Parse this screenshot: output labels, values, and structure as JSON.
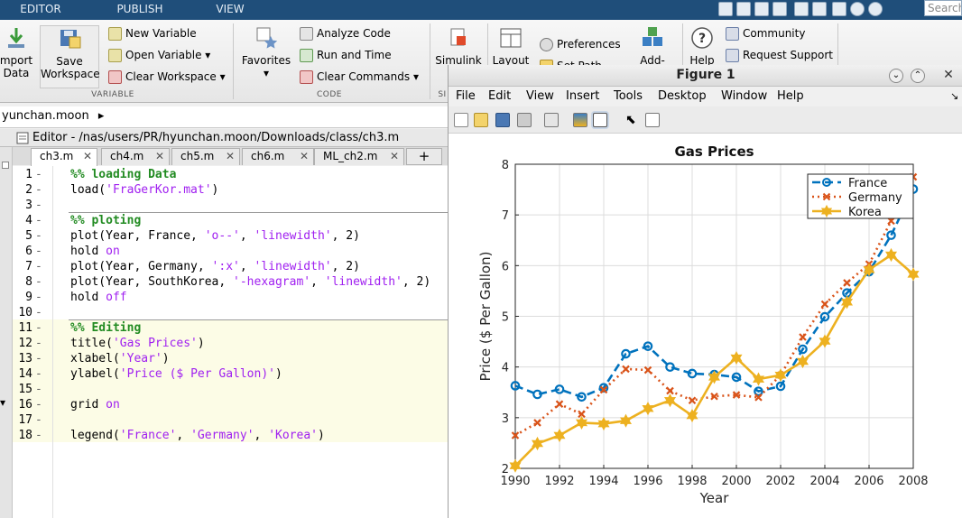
{
  "tabs": [
    {
      "label": "EDITOR"
    },
    {
      "label": "PUBLISH"
    },
    {
      "label": "VIEW"
    }
  ],
  "search": {
    "placeholder": "Search"
  },
  "ribbon": {
    "import_label": "mport\nData",
    "save_label": "Save\nWorkspace",
    "new_variable": "New Variable",
    "open_variable": "Open Variable",
    "clear_workspace": "Clear Workspace",
    "group_variable": "VARIABLE",
    "favorites": "Favorites",
    "analyze_code": "Analyze Code",
    "run_and_time": "Run and Time",
    "clear_commands": "Clear Commands",
    "group_code": "CODE",
    "group_sim": "SI",
    "simulink": "Simulink",
    "layout": "Layout",
    "preferences": "Preferences",
    "set_path": "Set Path",
    "add_ons": "Add-Ons",
    "help": "Help",
    "community": "Community",
    "request_support": "Request Support"
  },
  "path": {
    "text": "yunchan.moon"
  },
  "editor": {
    "title": "Editor - /nas/users/PR/hyunchan.moon/Downloads/class/ch3.m",
    "tabs": [
      "ch3.m",
      "ch4.m",
      "ch5.m",
      "ch6.m",
      "ML_ch2.m"
    ],
    "lines": [
      {
        "n": "1",
        "segs": [
          {
            "t": "%% loading Data",
            "c": "com"
          }
        ]
      },
      {
        "n": "2",
        "segs": [
          {
            "t": "load(",
            "c": ""
          },
          {
            "t": "'FraGerKor.mat'",
            "c": "str"
          },
          {
            "t": ")",
            "c": ""
          }
        ]
      },
      {
        "n": "3",
        "segs": []
      },
      {
        "n": "4",
        "segs": [
          {
            "t": "%% ploting",
            "c": "com"
          }
        ]
      },
      {
        "n": "5",
        "segs": [
          {
            "t": "plot(Year, France, ",
            "c": ""
          },
          {
            "t": "'o--'",
            "c": "str"
          },
          {
            "t": ", ",
            "c": ""
          },
          {
            "t": "'linewidth'",
            "c": "str"
          },
          {
            "t": ", 2)",
            "c": ""
          }
        ]
      },
      {
        "n": "6",
        "segs": [
          {
            "t": "hold ",
            "c": ""
          },
          {
            "t": "on",
            "c": "str"
          }
        ]
      },
      {
        "n": "7",
        "segs": [
          {
            "t": "plot(Year, Germany, ",
            "c": ""
          },
          {
            "t": "':x'",
            "c": "str"
          },
          {
            "t": ", ",
            "c": ""
          },
          {
            "t": "'linewidth'",
            "c": "str"
          },
          {
            "t": ", 2)",
            "c": ""
          }
        ]
      },
      {
        "n": "8",
        "segs": [
          {
            "t": "plot(Year, SouthKorea, ",
            "c": ""
          },
          {
            "t": "'-hexagram'",
            "c": "str"
          },
          {
            "t": ", ",
            "c": ""
          },
          {
            "t": "'linewidth'",
            "c": "str"
          },
          {
            "t": ", 2)",
            "c": ""
          }
        ]
      },
      {
        "n": "9",
        "segs": [
          {
            "t": "hold ",
            "c": ""
          },
          {
            "t": "off",
            "c": "str"
          }
        ]
      },
      {
        "n": "10",
        "segs": []
      },
      {
        "n": "11",
        "segs": [
          {
            "t": "%% Editing",
            "c": "com"
          }
        ]
      },
      {
        "n": "12",
        "segs": [
          {
            "t": "title(",
            "c": ""
          },
          {
            "t": "'Gas Prices'",
            "c": "str"
          },
          {
            "t": ")",
            "c": ""
          }
        ]
      },
      {
        "n": "13",
        "segs": [
          {
            "t": "xlabel(",
            "c": ""
          },
          {
            "t": "'Year'",
            "c": "str"
          },
          {
            "t": ")",
            "c": ""
          }
        ]
      },
      {
        "n": "14",
        "segs": [
          {
            "t": "ylabel(",
            "c": ""
          },
          {
            "t": "'Price ($ Per Gallon)'",
            "c": "str"
          },
          {
            "t": ")",
            "c": ""
          }
        ]
      },
      {
        "n": "15",
        "segs": []
      },
      {
        "n": "16",
        "segs": [
          {
            "t": "grid ",
            "c": ""
          },
          {
            "t": "on",
            "c": "str"
          }
        ]
      },
      {
        "n": "17",
        "segs": []
      },
      {
        "n": "18",
        "segs": [
          {
            "t": "legend(",
            "c": ""
          },
          {
            "t": "'France'",
            "c": "str"
          },
          {
            "t": ", ",
            "c": ""
          },
          {
            "t": "'Germany'",
            "c": "str"
          },
          {
            "t": ", ",
            "c": ""
          },
          {
            "t": "'Korea'",
            "c": "str"
          },
          {
            "t": ")",
            "c": ""
          }
        ]
      }
    ]
  },
  "figure": {
    "title": "Figure 1",
    "menu": [
      "File",
      "Edit",
      "View",
      "Insert",
      "Tools",
      "Desktop",
      "Window",
      "Help"
    ]
  },
  "colors": {
    "code_comment": "#228b22",
    "code_string": "#a020f0",
    "code_keyword": "#0000ff",
    "france": "#0072bd",
    "germany": "#d95319",
    "korea": "#edb120"
  },
  "chart_data": {
    "type": "line",
    "title": "Gas Prices",
    "xlabel": "Year",
    "ylabel": "Price ($ Per Gallon)",
    "xlim": [
      1990,
      2008
    ],
    "ylim": [
      2,
      8
    ],
    "xticks": [
      1990,
      1992,
      1994,
      1996,
      1998,
      2000,
      2002,
      2004,
      2006,
      2008
    ],
    "yticks": [
      2,
      3,
      4,
      5,
      6,
      7,
      8
    ],
    "grid": true,
    "legend_position": "top-right",
    "x": [
      1990,
      1991,
      1992,
      1993,
      1994,
      1995,
      1996,
      1997,
      1998,
      1999,
      2000,
      2001,
      2002,
      2003,
      2004,
      2005,
      2006,
      2007,
      2008
    ],
    "series": [
      {
        "name": "France",
        "style": "dashed, circle markers",
        "color": "#0072bd",
        "values": [
          3.63,
          3.46,
          3.56,
          3.41,
          3.59,
          4.26,
          4.41,
          4.0,
          3.87,
          3.85,
          3.8,
          3.52,
          3.62,
          4.35,
          4.99,
          5.46,
          5.88,
          6.6,
          7.51
        ]
      },
      {
        "name": "Germany",
        "style": "dotted, x markers",
        "color": "#d95319",
        "values": [
          2.65,
          2.9,
          3.27,
          3.07,
          3.55,
          3.96,
          3.94,
          3.53,
          3.34,
          3.42,
          3.45,
          3.4,
          3.84,
          4.59,
          5.24,
          5.66,
          6.03,
          6.88,
          7.75
        ]
      },
      {
        "name": "Korea",
        "style": "solid, hexagram markers",
        "color": "#edb120",
        "values": [
          2.05,
          2.49,
          2.65,
          2.9,
          2.88,
          2.94,
          3.18,
          3.34,
          3.04,
          3.8,
          4.18,
          3.76,
          3.84,
          4.11,
          4.51,
          5.28,
          5.92,
          6.21,
          5.83
        ]
      }
    ]
  }
}
